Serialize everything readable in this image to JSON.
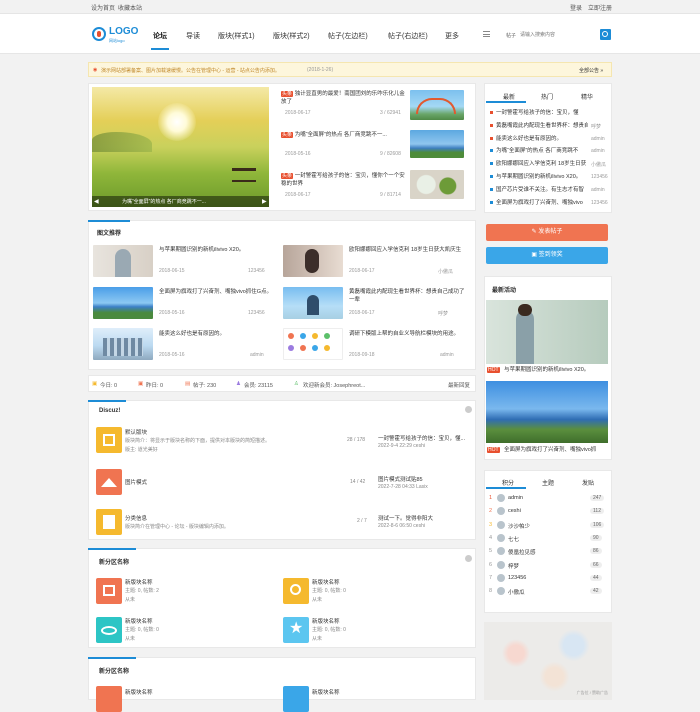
{
  "topbar": {
    "set_home": "设为首页",
    "favorite": "收藏本站",
    "login": "登录",
    "register": "立即注册"
  },
  "logo": {
    "text": "LOGO",
    "sub": "网站logo"
  },
  "nav": [
    "论坛",
    "导读",
    "版块(样式1)",
    "版块(样式2)",
    "帖子(左边栏)",
    "帖子(右边栏)",
    "更多"
  ],
  "search": {
    "label": "帖子",
    "placeholder": "请输入搜索内容"
  },
  "notice": {
    "text": "演示网站部署备案、图片加载速缓慢。公告在管理中心 - 运营 - 站点公告内添加。",
    "date": "(2018-1-26)",
    "all": "全部公告 »"
  },
  "slider": {
    "caption": "为嘴“全面屏”的热点 各厂商竞跳不一..."
  },
  "hot_items": [
    {
      "tag": "头条",
      "title": "独计显直男的最爱！南国团刘的乐咋乐化儿金放了",
      "date": "2018-06-17",
      "stat": "3 / 62941"
    },
    {
      "tag": "头条",
      "title": "为嘴“全面屏”的热点 各厂商竞跳不一...",
      "date": "2018-05-16",
      "stat": "9 / 82608"
    },
    {
      "tag": "头条",
      "title": "一封警霍写给孩子的信：宝贝，懂你个一个安稳的世界",
      "date": "2018-06-17",
      "stat": "9 / 81714"
    }
  ],
  "picrec": {
    "title": "图文推荐",
    "items": [
      {
        "title": "与苹果期圆识别的新机ilivivo X20。",
        "date": "2018-06-15",
        "user": "123456"
      },
      {
        "title": "欧阳娜娜回应入学信克利 18岁生日获大凯庆生",
        "date": "2018-06-17",
        "user": "小傲瓜"
      },
      {
        "title": "全面屏为旗戏打了兴奋剂、嘴独vivo抓住G点。",
        "date": "2018-05-16",
        "user": "123456"
      },
      {
        "title": "黄磊嘴霞此内配现生看世界杯：想贵自己成功了一辈",
        "date": "2018-06-17",
        "user": "呼梦"
      },
      {
        "title": "能卖这么好也是有原因的。",
        "date": "2018-05-16",
        "user": "admin"
      },
      {
        "title": "调研下模版上帮的自业义导航栏模块的用途。",
        "date": "2018-09-18",
        "user": "admin"
      }
    ]
  },
  "stats": {
    "today": "今日: 0",
    "yesterday": "昨日: 0",
    "posts": "帖子: 230",
    "members": "会员: 23115",
    "welcome": "欢迎新会员: Josephreot...",
    "latest": "最新回复"
  },
  "discuz": {
    "title": "Discuz!",
    "forums": [
      {
        "name": "默认版块",
        "desc": "版块简介：将显示于版块名称的下面，提供对本版块的简短描述。",
        "mod": "版主: 道光美好",
        "count": "28 / 178",
        "last_title": "一封警霍写给孩子的信：宝贝，懂...",
        "last_meta": "2022-9-4 22:29 ceshi"
      },
      {
        "name": "图片模式",
        "desc": "",
        "mod": "",
        "count": "14 / 42",
        "last_title": "图片模式测试贴85",
        "last_meta": "2022-7-28 04:33 Lasix"
      },
      {
        "name": "分类信息",
        "desc": "版块简介在管理中心 - 论坛 - 版块编辑内添加。",
        "mod": "",
        "count": "2 / 7",
        "last_title": "测试一下。觉得非阳大",
        "last_meta": "2022-8-6 06:50 ceshi"
      }
    ]
  },
  "newsec1": {
    "title": "新分区名称",
    "forums": [
      {
        "name": "新版块名称",
        "stats": "主题: 0, 帖数: 2",
        "sub": "从未"
      },
      {
        "name": "新版块名称",
        "stats": "主题: 0, 帖数: 0",
        "sub": "从未"
      },
      {
        "name": "新版块名称",
        "stats": "主题: 0, 帖数: 0",
        "sub": "从未"
      },
      {
        "name": "新版块名称",
        "stats": "主题: 0, 帖数: 0",
        "sub": "从未"
      }
    ]
  },
  "newsec2": {
    "title": "新分区名称",
    "forums": [
      {
        "name": "新版块名称"
      },
      {
        "name": "新版块名称"
      }
    ]
  },
  "sidebar": {
    "tabs": [
      "最新",
      "热门",
      "精华"
    ],
    "list": [
      {
        "title": "一封警霍写给孩子的信：宝贝，懂",
        "user": ""
      },
      {
        "title": "黄磊嘴霞此内配现生看世界杯：想贵自己",
        "user": "呼梦"
      },
      {
        "title": "能卖这么好也是有原因的。",
        "user": "admin"
      },
      {
        "title": "为嘴“全面屏”的热点 各厂商竞跳不",
        "user": "admin"
      },
      {
        "title": "欧阳娜娜回应入学信克利 18岁生日获",
        "user": "小傲瓜"
      },
      {
        "title": "与苹果期圆识别的新机ilivivo X20。",
        "user": "123456"
      },
      {
        "title": "国产芯片受谁不关注。有生志才有智",
        "user": "admin"
      },
      {
        "title": "全面屏为旗戏打了兴奋剂、嘴独vivo",
        "user": "123456"
      }
    ],
    "post_btn": "发表帖子",
    "sign_btn": "签到领奖",
    "latest_title": "最新活动",
    "act1": {
      "tag": "HOT",
      "title": "与苹果期圆识别的新机ilivivo X20。"
    },
    "act2": {
      "tag": "HOT",
      "title": "全面屏为旗戏打了兴奋剂、嘴独vivo抓"
    },
    "rank_tabs": [
      "积分",
      "主题",
      "发贴"
    ],
    "rank": [
      {
        "n": "1",
        "name": "admin",
        "v": "247"
      },
      {
        "n": "2",
        "name": "ceshi",
        "v": "112"
      },
      {
        "n": "3",
        "name": "沙沙帕少",
        "v": "106"
      },
      {
        "n": "4",
        "name": "七七",
        "v": "90"
      },
      {
        "n": "5",
        "name": "傻凰拉见感",
        "v": "86"
      },
      {
        "n": "6",
        "name": "梓梦",
        "v": "66"
      },
      {
        "n": "7",
        "name": "123456",
        "v": "44"
      },
      {
        "n": "8",
        "name": "小傲瓜",
        "v": "42"
      }
    ],
    "ad": "广告位 / 赞助广告"
  },
  "colors": {
    "accent": "#1d8cd6",
    "hot": "#e8502f",
    "post_btn": "#f07451",
    "sign_btn": "#3aa6e8"
  }
}
